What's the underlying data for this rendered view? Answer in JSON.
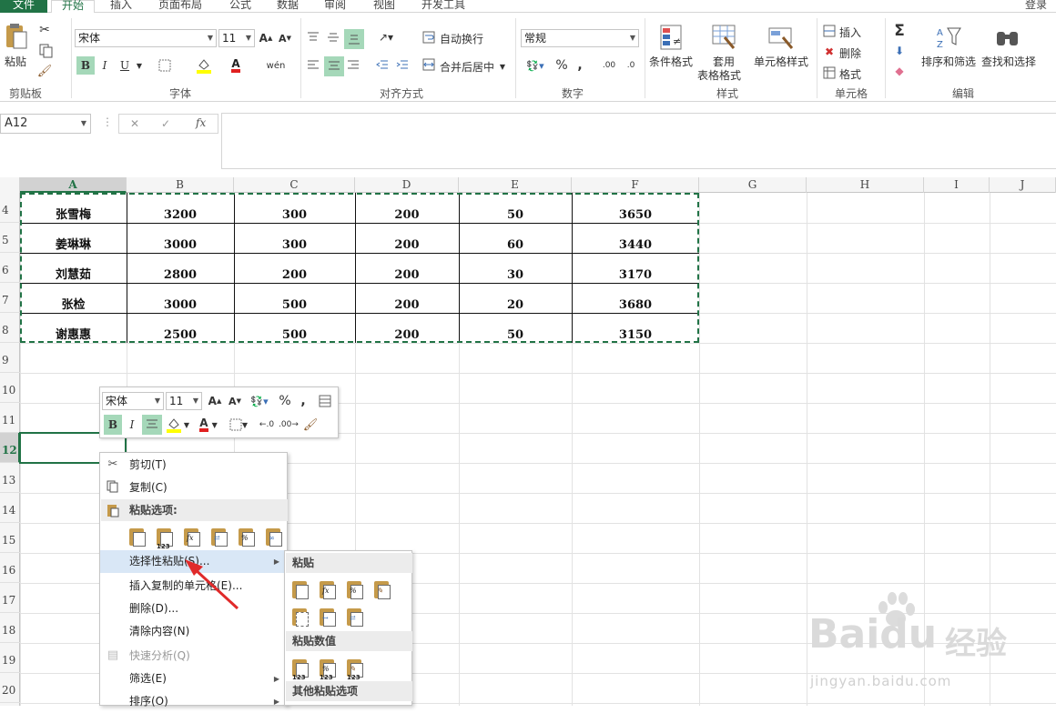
{
  "tabs": [
    "文件",
    "开始",
    "插入",
    "页面布局",
    "公式",
    "数据",
    "审阅",
    "视图",
    "开发工具"
  ],
  "account": "登录",
  "ribbon": {
    "clipboard": {
      "paste": "粘贴",
      "label": "剪贴板"
    },
    "font": {
      "name": "宋体",
      "size": "11",
      "bold": "B",
      "italic": "I",
      "underline": "U",
      "font_color_letter": "A",
      "phonetic": "wén",
      "label": "字体"
    },
    "align": {
      "wrap": "自动换行",
      "merge": "合并后居中",
      "label": "对齐方式"
    },
    "number": {
      "format": "常规",
      "label": "数字",
      "percent": "%",
      "comma": ",",
      "inc_decimal": ".00",
      "dec_decimal": ".0"
    },
    "styles": {
      "conditional": "条件格式",
      "table1": "套用",
      "table2": "表格格式",
      "cell": "单元格样式",
      "label": "样式"
    },
    "cells": {
      "insert": "插入",
      "delete": "删除",
      "format": "格式",
      "label": "单元格"
    },
    "edit": {
      "sigma": "Σ",
      "sort": "排序和筛选",
      "find": "查找和选择",
      "label": "编辑"
    }
  },
  "formula_bar": {
    "name_box": "A12",
    "fx": "fx",
    "cancel": "✕",
    "enter": "✓"
  },
  "columns": [
    "A",
    "B",
    "C",
    "D",
    "E",
    "F",
    "G",
    "H",
    "I",
    "J"
  ],
  "rows": [
    "4",
    "5",
    "6",
    "7",
    "8",
    "9",
    "10",
    "11",
    "12",
    "13",
    "14",
    "15",
    "16",
    "17",
    "18",
    "19",
    "20"
  ],
  "table": [
    [
      "张雪梅",
      "3200",
      "300",
      "200",
      "50",
      "3650"
    ],
    [
      "姜琳琳",
      "3000",
      "300",
      "200",
      "60",
      "3440"
    ],
    [
      "刘慧茹",
      "2800",
      "200",
      "200",
      "30",
      "3170"
    ],
    [
      "张检",
      "3000",
      "500",
      "200",
      "20",
      "3680"
    ],
    [
      "谢惠惠",
      "2500",
      "500",
      "200",
      "50",
      "3150"
    ]
  ],
  "mini_toolbar": {
    "font": "宋体",
    "size": "11",
    "bold": "B",
    "italic": "I",
    "percent": "%",
    "comma": ",",
    "font_color_letter": "A"
  },
  "context_menu": {
    "cut": "剪切(T)",
    "copy": "复制(C)",
    "paste_options": "粘贴选项:",
    "paste_special": "选择性粘贴(S)...",
    "insert_copied": "插入复制的单元格(E)...",
    "delete": "删除(D)...",
    "clear": "清除内容(N)",
    "quick_analysis": "快速分析(Q)",
    "filter": "筛选(E)",
    "sort": "排序(O)"
  },
  "submenu": {
    "paste": "粘贴",
    "paste_values": "粘贴数值",
    "other": "其他粘贴选项"
  },
  "paste_icon_tag": "123",
  "watermark": {
    "brand": "Baidu",
    "cn": "经验",
    "url": "jingyan.baidu.com"
  },
  "colors": {
    "excel_green": "#217346",
    "highlight": "#a5d8b9",
    "arrow": "#e02a2a"
  }
}
